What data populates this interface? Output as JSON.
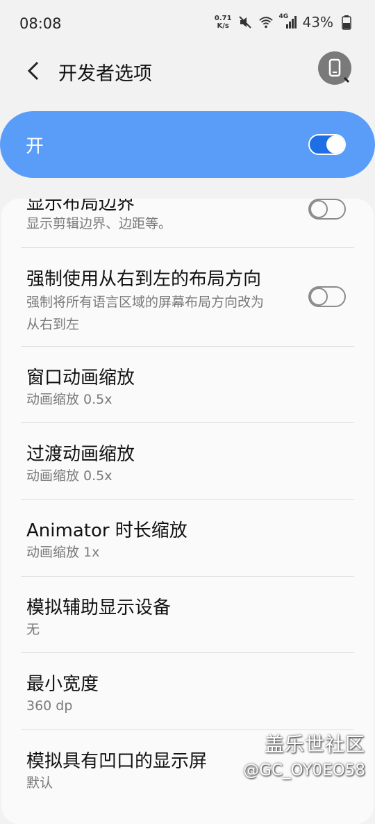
{
  "status_bar": {
    "time": "08:08",
    "net_speed_value": "0.71",
    "net_speed_unit": "K/s",
    "icons": [
      "mute-icon",
      "wifi-icon",
      "4g-signal-icon",
      "battery-icon"
    ],
    "signal_label": "4G",
    "battery": "43%"
  },
  "header": {
    "title": "开发者选项"
  },
  "master_switch": {
    "label": "开",
    "on": true
  },
  "settings": {
    "show_layout_bounds": {
      "title": "显示布局边界",
      "summary": "显示剪辑边界、边距等。",
      "on": false
    },
    "force_rtl": {
      "title": "强制使用从右到左的布局方向",
      "summary_line1": "强制将所有语言区域的屏幕布局方向改为",
      "summary_line2": "从右到左",
      "on": false
    },
    "window_anim": {
      "title": "窗口动画缩放",
      "summary": "动画缩放 0.5x"
    },
    "transition_anim": {
      "title": "过渡动画缩放",
      "summary": "动画缩放 0.5x"
    },
    "animator_duration": {
      "title": "Animator 时长缩放",
      "summary": "动画缩放 1x"
    },
    "simulate_display": {
      "title": "模拟辅助显示设备",
      "summary": "无"
    },
    "min_width": {
      "title": "最小宽度",
      "summary": "360 dp"
    },
    "display_cutout": {
      "title": "模拟具有凹口的显示屏",
      "summary": "默认"
    }
  },
  "watermark": {
    "line1": "盖乐世社区",
    "line2": "@GC_OY0EO58"
  },
  "colors": {
    "accent": "#1a73e8",
    "master_bg": "#5a9df8"
  }
}
